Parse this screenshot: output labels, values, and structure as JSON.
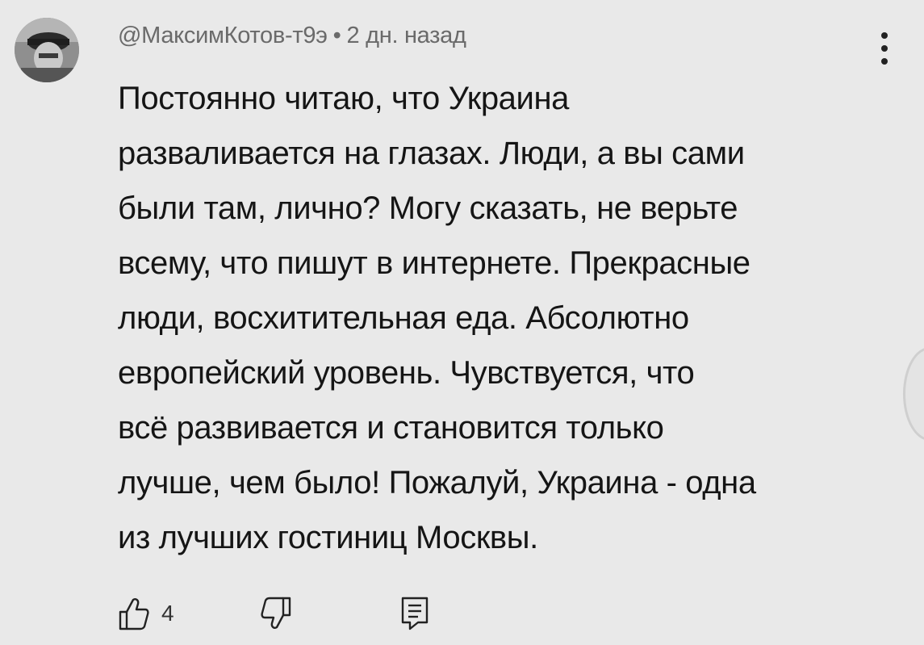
{
  "comment": {
    "author": "@МаксимКотов-т9э",
    "separator": "•",
    "timestamp": "2 дн. назад",
    "text_lines": [
      "Постоянно читаю, что Украина",
      "разваливается на глазах. Люди, а вы сами",
      "были там, лично? Могу сказать, не верьте",
      "всему, что пишут в интернете. Прекрасные",
      "люди, восхитительная еда. Абсолютно",
      "европейский уровень. Чувствуется, что",
      "всё развивается и становится только",
      "лучше, чем было! Пожалуй, Украина - одна",
      "из лучших гостиниц Москвы."
    ],
    "like_count": "4"
  },
  "icons": {
    "avatar": "user-avatar-photo",
    "more": "more-vert-icon",
    "like": "thumb-up-icon",
    "dislike": "thumb-down-icon",
    "reply": "reply-icon"
  }
}
